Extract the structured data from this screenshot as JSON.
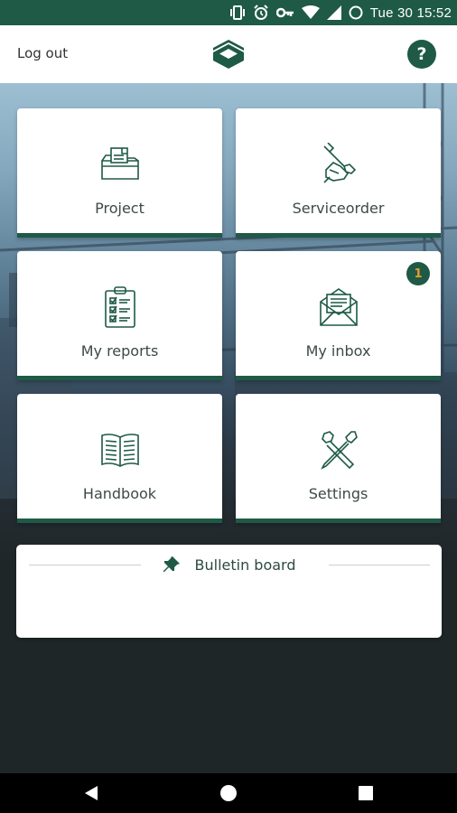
{
  "status_bar": {
    "time": "Tue 30 15:52",
    "icons": [
      "vibrate-icon",
      "alarm-icon",
      "vpn-key-icon",
      "wifi-icon",
      "signal-icon",
      "battery-icon"
    ]
  },
  "header": {
    "logout_label": "Log out",
    "help_label": "?",
    "logo_icon": "app-logo-icon"
  },
  "tiles": [
    {
      "label": "Project",
      "icon": "folder-documents-icon"
    },
    {
      "label": "Serviceorder",
      "icon": "wrench-hand-icon"
    },
    {
      "label": "My reports",
      "icon": "clipboard-checklist-icon"
    },
    {
      "label": "My inbox",
      "icon": "open-envelope-icon",
      "badge": "1"
    },
    {
      "label": "Handbook",
      "icon": "open-book-icon"
    },
    {
      "label": "Settings",
      "icon": "tools-icon"
    }
  ],
  "bulletin": {
    "title": "Bulletin board",
    "icon": "pin-icon"
  },
  "nav_bar": {
    "icons": [
      "back-icon",
      "home-icon",
      "recents-icon"
    ]
  },
  "colors": {
    "brand": "#1e5a45",
    "badge_text": "#e89b2f"
  }
}
